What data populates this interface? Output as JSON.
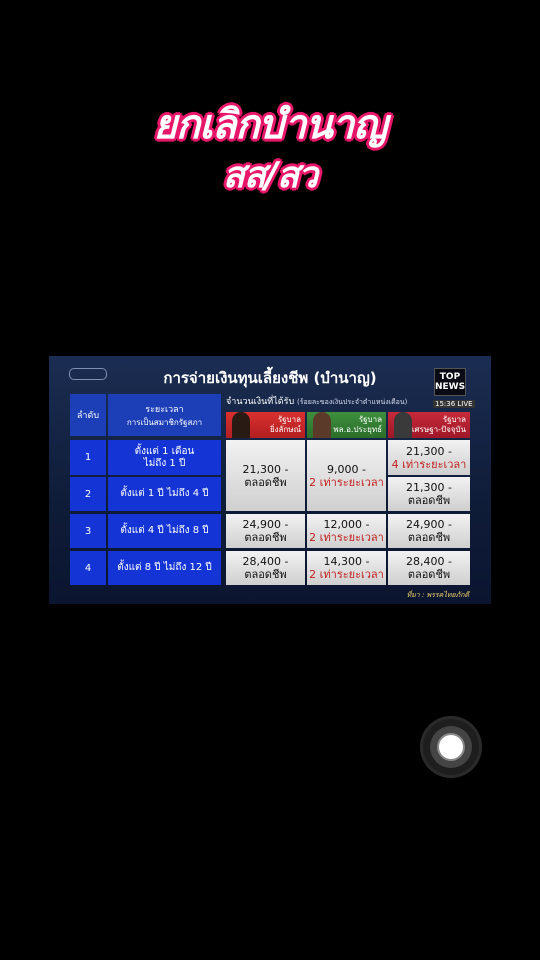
{
  "caption": {
    "line1": "ยกเลิกบำนาญ",
    "line2": "สส/สว",
    "color": "#e8176a"
  },
  "panel": {
    "title": "การจ่ายเงินทุนเลี้ยงชีพ (บำนาญ)",
    "channel_logo": "TOP NEWS",
    "live_label": "15:36 LIVE",
    "headers": {
      "rank": "ลำดับ",
      "duration_main": "ระยะเวลา",
      "duration_sub": "การเป็นสมาชิกรัฐสภา",
      "amount_main": "จำนวนเงินที่ได้รับ",
      "amount_sub": "(ร้อยละของเงินประจำตำแหน่งเดือน)"
    },
    "governments": [
      {
        "line1": "รัฐบาล",
        "line2": "ยิ่งลักษณ์"
      },
      {
        "line1": "รัฐบาล",
        "line2": "พล.อ.ประยุทธ์"
      },
      {
        "line1": "รัฐบาล",
        "line2": "เศรษฐา-ปัจจุบัน"
      }
    ],
    "rows": [
      {
        "rank": "1",
        "dur1": "ตั้งแต่ 1 เดือน",
        "dur2": "ไม่ถึง 1 ปี"
      },
      {
        "rank": "2",
        "dur1": "ตั้งแต่ 1 ปี ไม่ถึง 4 ปี",
        "dur2": ""
      },
      {
        "rank": "3",
        "dur1": "ตั้งแต่ 4 ปี ไม่ถึง 8 ปี",
        "dur2": ""
      },
      {
        "rank": "4",
        "dur1": "ตั้งแต่ 8 ปี ไม่ถึง 12 ปี",
        "dur2": ""
      }
    ],
    "values": {
      "g1_r12_a": "21,300 -",
      "g1_r12_b": "ตลอดชีพ",
      "g2_r12_a": "9,000 -",
      "g2_r12_b": "2 เท่าระยะเวลา",
      "g3_r1_a": "21,300 -",
      "g3_r1_b": "4 เท่าระยะเวลา",
      "g3_r2_a": "21,300 -",
      "g3_r2_b": "ตลอดชีพ",
      "g1_r3_a": "24,900 -",
      "g1_r3_b": "ตลอดชีพ",
      "g2_r3_a": "12,000 -",
      "g2_r3_b": "2 เท่าระยะเวลา",
      "g3_r3_a": "24,900 -",
      "g3_r3_b": "ตลอดชีพ",
      "g1_r4_a": "28,400 -",
      "g1_r4_b": "ตลอดชีพ",
      "g2_r4_a": "14,300 -",
      "g2_r4_b": "2 เท่าระยะเวลา",
      "g3_r4_a": "28,400 -",
      "g3_r4_b": "ตลอดชีพ"
    },
    "source": "ที่มา : พรรคไทยภักดี"
  }
}
